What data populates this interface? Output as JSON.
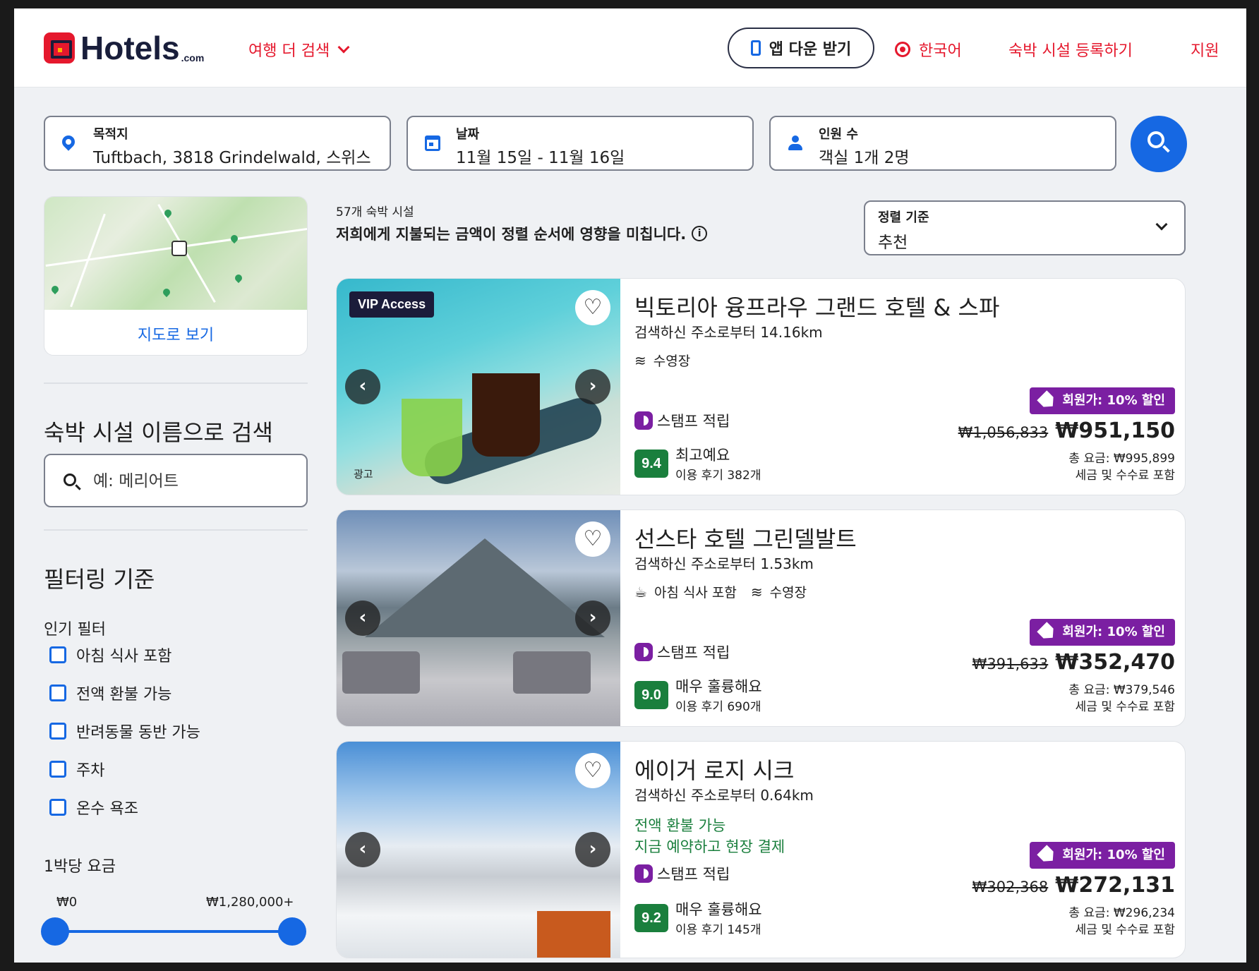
{
  "header": {
    "logo": "Hotels",
    "logo_suffix": ".com",
    "more_travel": "여행 더 검색",
    "app_button": "앱 다운 받기",
    "language": "한국어",
    "list_property": "숙박 시설 등록하기",
    "support": "지원",
    "brand_color": "#e5182d",
    "accent_color": "#1668e3"
  },
  "search": {
    "destination_label": "목적지",
    "destination_value": "Tuftbach, 3818 Grindelwald, 스위스",
    "dates_label": "날짜",
    "dates_value": "11월 15일 - 11월 16일",
    "guests_label": "인원 수",
    "guests_value": "객실 1개 2명",
    "search_icon": "search-icon"
  },
  "sidebar": {
    "map_link": "지도로 보기",
    "name_search_title": "숙박 시설 이름으로 검색",
    "name_search_placeholder": "예: 메리어트",
    "filter_title": "필터링 기준",
    "popular_label": "인기 필터",
    "filters": [
      {
        "label": "아침 식사 포함",
        "checked": false
      },
      {
        "label": "전액 환불 가능",
        "checked": false
      },
      {
        "label": "반려동물 동반 가능",
        "checked": false
      },
      {
        "label": "주차",
        "checked": false
      },
      {
        "label": "온수 욕조",
        "checked": false
      }
    ],
    "price_label": "1박당 요금",
    "price_min": "₩0",
    "price_max": "₩1,280,000+"
  },
  "results": {
    "count": "57개 숙박 시설",
    "sort_note": "저희에게 지불되는 금액이 정렬 순서에 영향을 미칩니다.",
    "sort_label": "정렬 기준",
    "sort_value": "추천"
  },
  "hotels": [
    {
      "name": "빅토리아 융프라우 그랜드 호텔 & 스파",
      "distance": "검색하신 주소로부터 14.16km",
      "amenities": [
        "수영장"
      ],
      "badge": "VIP Access",
      "ad": "광고",
      "stamp": "스탬프 적립",
      "score": "9.4",
      "rating_word": "최고예요",
      "reviews": "이용 후기 382개",
      "member_deal": "회원가: 10% 할인",
      "old_price": "₩1,056,833",
      "price": "₩951,150",
      "total": "총 요금: ₩995,899",
      "taxes": "세금 및 수수료 포함"
    },
    {
      "name": "선스타 호텔 그린델발트",
      "distance": "검색하신 주소로부터 1.53km",
      "amenities": [
        "아침 식사 포함",
        "수영장"
      ],
      "stamp": "스탬프 적립",
      "score": "9.0",
      "rating_word": "매우 훌륭해요",
      "reviews": "이용 후기 690개",
      "member_deal": "회원가: 10% 할인",
      "old_price": "₩391,633",
      "price": "₩352,470",
      "total": "총 요금: ₩379,546",
      "taxes": "세금 및 수수료 포함"
    },
    {
      "name": "에이거 로지 시크",
      "distance": "검색하신 주소로부터 0.64km",
      "perks": [
        "전액 환불 가능",
        "지금 예약하고 현장 결제"
      ],
      "stamp": "스탬프 적립",
      "score": "9.2",
      "rating_word": "매우 훌륭해요",
      "reviews": "이용 후기 145개",
      "member_deal": "회원가: 10% 할인",
      "old_price": "₩302,368",
      "price": "₩272,131",
      "total": "총 요금: ₩296,234",
      "taxes": "세금 및 수수료 포함"
    }
  ]
}
